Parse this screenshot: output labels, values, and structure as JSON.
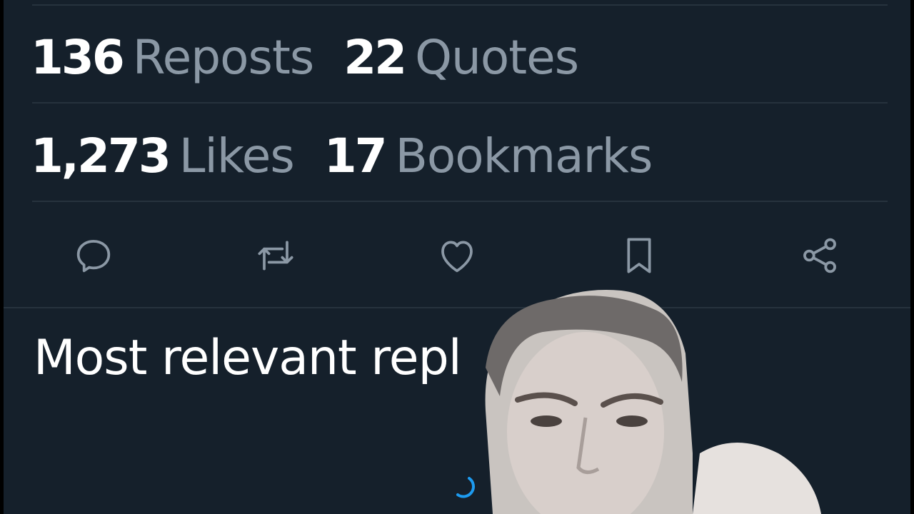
{
  "stats": {
    "reposts": {
      "count": "136",
      "label": "Reposts"
    },
    "quotes": {
      "count": "22",
      "label": "Quotes"
    },
    "likes": {
      "count": "1,273",
      "label": "Likes"
    },
    "bookmarks": {
      "count": "17",
      "label": "Bookmarks"
    }
  },
  "actions": {
    "reply_icon": "reply-icon",
    "repost_icon": "repost-icon",
    "like_icon": "heart-icon",
    "bookmark_icon": "bookmark-icon",
    "share_icon": "share-icon"
  },
  "replies": {
    "title": "Most relevant repl"
  },
  "colors": {
    "background": "#15202b",
    "primary_text": "#ffffff",
    "secondary_text": "#8b98a5",
    "divider": "#26323d",
    "accent": "#1d9bf0"
  }
}
